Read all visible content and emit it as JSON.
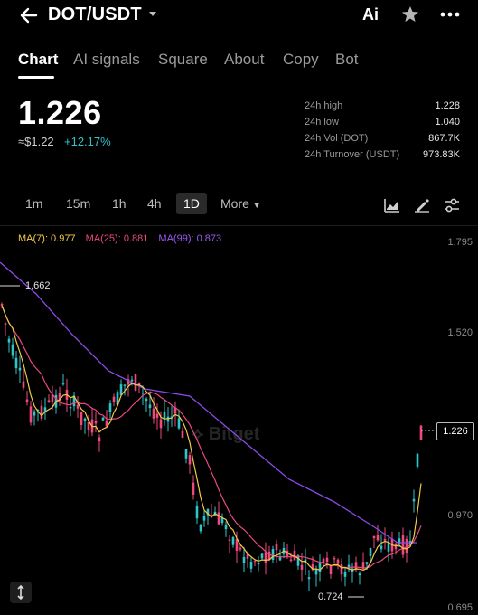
{
  "header": {
    "pair": "DOT/USDT",
    "ai_label": "Ai"
  },
  "tabs": [
    {
      "label": "Chart",
      "active": true
    },
    {
      "label": "AI signals"
    },
    {
      "label": "Square"
    },
    {
      "label": "About"
    },
    {
      "label": "Copy"
    },
    {
      "label": "Bot"
    }
  ],
  "ticker": {
    "price": "1.226",
    "approx": "≈$1.22",
    "change": "+12.17%",
    "stats": [
      {
        "label": "24h high",
        "value": "1.228"
      },
      {
        "label": "24h low",
        "value": "1.040"
      },
      {
        "label": "24h Vol (DOT)",
        "value": "867.7K"
      },
      {
        "label": "24h Turnover (USDT)",
        "value": "973.83K"
      }
    ]
  },
  "timeframes": {
    "items": [
      "1m",
      "15m",
      "1h",
      "4h",
      "1D"
    ],
    "selected": "1D",
    "more_label": "More"
  },
  "indicators": {
    "ma7": "MA(7): 0.977",
    "ma25": "MA(25): 0.881",
    "ma99": "MA(99): 0.873"
  },
  "chart_data": {
    "type": "candlestick",
    "y_ticks": [
      "1.795",
      "1.520",
      "0.970",
      "0.695"
    ],
    "current_price": "1.226",
    "high_marker": "1.662",
    "low_marker": "0.724",
    "watermark": "Bitget",
    "colors": {
      "up": "#2ec4c9",
      "down": "#f0497b",
      "ma7": "#f2c94c",
      "ma25": "#e84a7f",
      "ma99": "#8a4be8"
    }
  },
  "icons": {
    "back": "back-arrow-icon",
    "caret": "chevron-down-icon",
    "star": "star-icon",
    "more": "more-dots-icon",
    "chart_type": "chart-type-icon",
    "draw": "draw-pen-icon",
    "settings": "indicator-settings-icon",
    "expand": "expand-icon"
  }
}
